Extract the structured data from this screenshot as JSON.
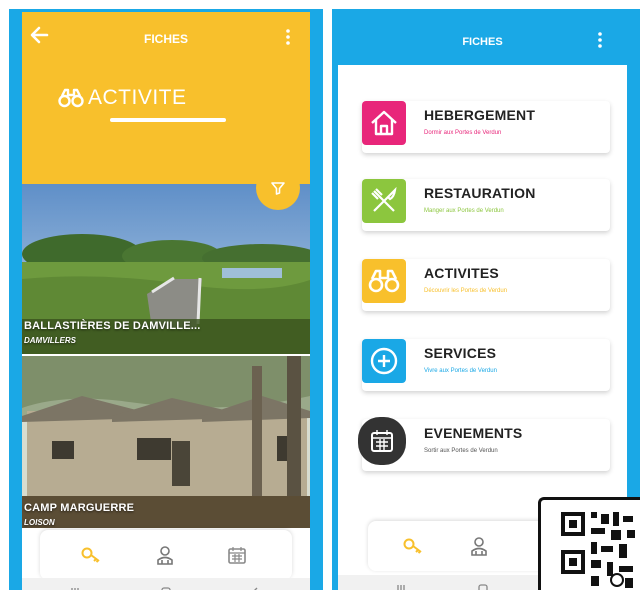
{
  "left_screen": {
    "header_title": "FICHES",
    "section_title": "ACTIVITE",
    "cards": [
      {
        "name": "BALLASTIÈRES DE DAMVILLE...",
        "place": "DAMVILLERS"
      },
      {
        "name": "CAMP MARGUERRE",
        "place": "LOISON"
      }
    ]
  },
  "right_screen": {
    "header_title": "FICHES",
    "menu": [
      {
        "title": "HEBERGEMENT",
        "subtitle": "Dormir aux Portes de Verdun",
        "color": "#e8267a",
        "icon": "house-icon"
      },
      {
        "title": "RESTAURATION",
        "subtitle": "Manger aux Portes de Verdun",
        "color": "#8cc63e",
        "icon": "fork-knife-icon"
      },
      {
        "title": "ACTIVITES",
        "subtitle": "Découvrir les Portes de Verdun",
        "color": "#f8c02c",
        "icon": "binoculars-icon"
      },
      {
        "title": "SERVICES",
        "subtitle": "Vivre aux Portes de Verdun",
        "color": "#1aa8e6",
        "icon": "plus-circle-icon"
      },
      {
        "title": "EVENEMENTS",
        "subtitle": "Sortir aux Portes de Verdun",
        "color": "#333333",
        "icon": "calendar-icon"
      }
    ]
  },
  "colors": {
    "yellow": "#f8c02c",
    "blue": "#1aa8e6"
  }
}
